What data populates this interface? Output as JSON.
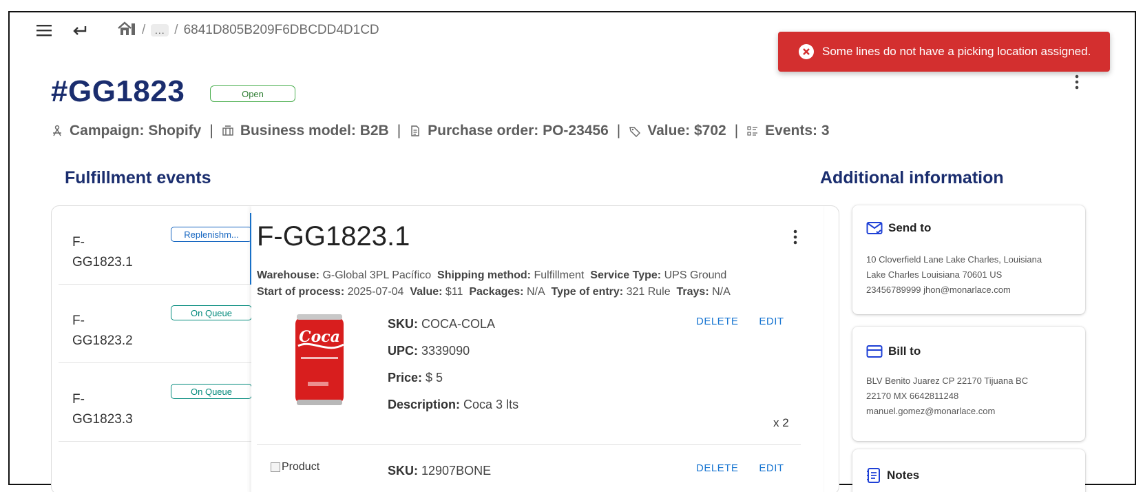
{
  "topbar": {
    "breadcrumb": [
      "...",
      "6841D805B209F6DBCDD4D1CD"
    ]
  },
  "toast": {
    "message": "Some lines do not have a picking location assigned.",
    "color": "#d32f2f"
  },
  "order": {
    "title": "#GG1823",
    "status": "Open",
    "meta": {
      "campaign": "Campaign: Shopify",
      "business_model": "Business model: B2B",
      "purchase_order": "Purchase order: PO-23456",
      "value": "Value: $702",
      "events": "Events: 3"
    }
  },
  "sections": {
    "fulfillment": "Fulfillment events",
    "additional": "Additional information"
  },
  "events": [
    {
      "id": "F-\nGG1823.1",
      "id_line1": "F-",
      "id_line2": "GG1823.1",
      "badge": "Replenishm...",
      "badge_style": "blue"
    },
    {
      "id": "F-\nGG1823.2",
      "id_line1": "F-",
      "id_line2": "GG1823.2",
      "badge": "On Queue",
      "badge_style": "teal"
    },
    {
      "id": "F-\nGG1823.3",
      "id_line1": "F-",
      "id_line2": "GG1823.3",
      "badge": "On Queue",
      "badge_style": "teal"
    }
  ],
  "detail": {
    "title": "F-GG1823.1",
    "warehouse_label": "Warehouse:",
    "warehouse": "G-Global 3PL Pacífico",
    "shipping_label": "Shipping method:",
    "shipping": "Fulfillment",
    "service_label": "Service Type:",
    "service": "UPS Ground",
    "start_label": "Start of process:",
    "start": "2025-07-04",
    "value_label": "Value:",
    "value": "$11",
    "packages_label": "Packages:",
    "packages": "N/A",
    "entry_label": "Type of entry:",
    "entry": "321 Rule",
    "trays_label": "Trays:",
    "trays": "N/A",
    "products": [
      {
        "sku_label": "SKU:",
        "sku": "COCA-COLA",
        "upc_label": "UPC:",
        "upc": "3339090",
        "price_label": "Price:",
        "price": "$ 5",
        "desc_label": "Description:",
        "desc": "Coca 3 lts",
        "qty": "x 2",
        "delete": "DELETE",
        "edit": "EDIT"
      },
      {
        "img_alt": "Product",
        "sku_label": "SKU:",
        "sku": "12907BONE",
        "delete": "DELETE",
        "edit": "EDIT"
      }
    ]
  },
  "cards": {
    "send_to": {
      "title": "Send to",
      "lines": [
        "10 Cloverfield Lane Lake Charles, Louisiana",
        "Lake Charles Louisiana 70601 US",
        "23456789999 jhon@monarlace.com"
      ]
    },
    "bill_to": {
      "title": "Bill to",
      "lines": [
        "BLV Benito Juarez CP 22170 Tijuana BC",
        "22170 MX 6642811248",
        "manuel.gomez@monarlace.com"
      ]
    },
    "notes": {
      "title": "Notes"
    }
  }
}
